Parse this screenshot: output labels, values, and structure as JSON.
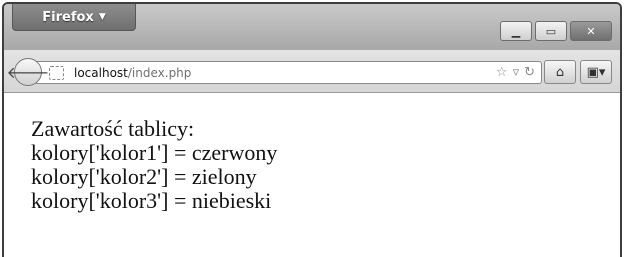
{
  "browser": {
    "menu_button_label": "Firefox",
    "window_controls": [
      "minimize",
      "maximize",
      "close"
    ]
  },
  "navbar": {
    "url_host": "localhost",
    "url_path": "/index.php",
    "icons": [
      "back-arrow-icon",
      "bookmark-star-icon",
      "dropmarker-icon",
      "reload-icon",
      "home-icon",
      "bookmarks-menu-icon"
    ]
  },
  "page": {
    "lines": [
      "Zawartość tablicy:",
      "kolory['kolor1'] = czerwony",
      "kolory['kolor2'] = zielony",
      "kolory['kolor3'] = niebieski"
    ]
  }
}
